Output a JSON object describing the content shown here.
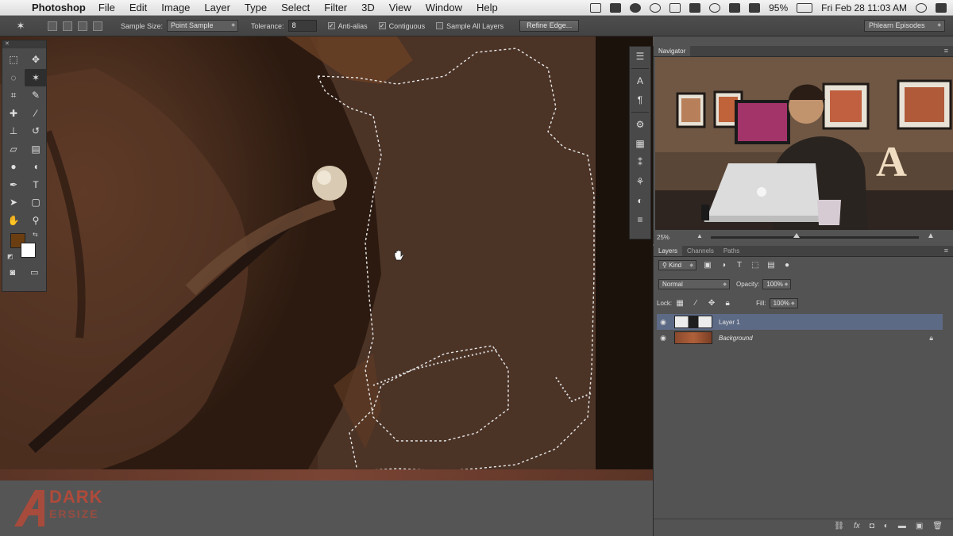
{
  "menubar": {
    "app_name": "Photoshop",
    "menus": [
      "File",
      "Edit",
      "Image",
      "Layer",
      "Type",
      "Select",
      "Filter",
      "3D",
      "View",
      "Window",
      "Help"
    ],
    "battery": "95%",
    "clock": "Fri Feb 28  11:03 AM"
  },
  "options_bar": {
    "sample_size_label": "Sample Size:",
    "sample_size_value": "Point Sample",
    "tolerance_label": "Tolerance:",
    "tolerance_value": "8",
    "anti_alias_label": "Anti-alias",
    "anti_alias_checked": true,
    "contiguous_label": "Contiguous",
    "contiguous_checked": true,
    "sample_all_layers_label": "Sample All Layers",
    "sample_all_layers_checked": false,
    "refine_edge_label": "Refine Edge...",
    "workspace_label": "Phlearn Episodes"
  },
  "tool_colors": {
    "foreground": "#6b3e12",
    "background": "#ffffff"
  },
  "navigator": {
    "tab_label": "Navigator",
    "zoom_value": "25%"
  },
  "layers_panel": {
    "tabs": [
      "Layers",
      "Channels",
      "Paths"
    ],
    "filter_kind": "Kind",
    "blend_mode": "Normal",
    "opacity_label": "Opacity:",
    "opacity_value": "100%",
    "lock_label": "Lock:",
    "fill_label": "Fill:",
    "fill_value": "100%",
    "layers": [
      {
        "name": "Layer 1",
        "selected": true,
        "visible": true
      },
      {
        "name": "Background",
        "selected": false,
        "visible": true,
        "locked": true
      }
    ]
  },
  "watermark": {
    "text_top": "DARK",
    "text_bottom": "ERSIZE"
  },
  "colors": {
    "accent_selected_layer": "#5d6a85",
    "panel_bg": "#535353",
    "watermark": "#b04a3a"
  }
}
